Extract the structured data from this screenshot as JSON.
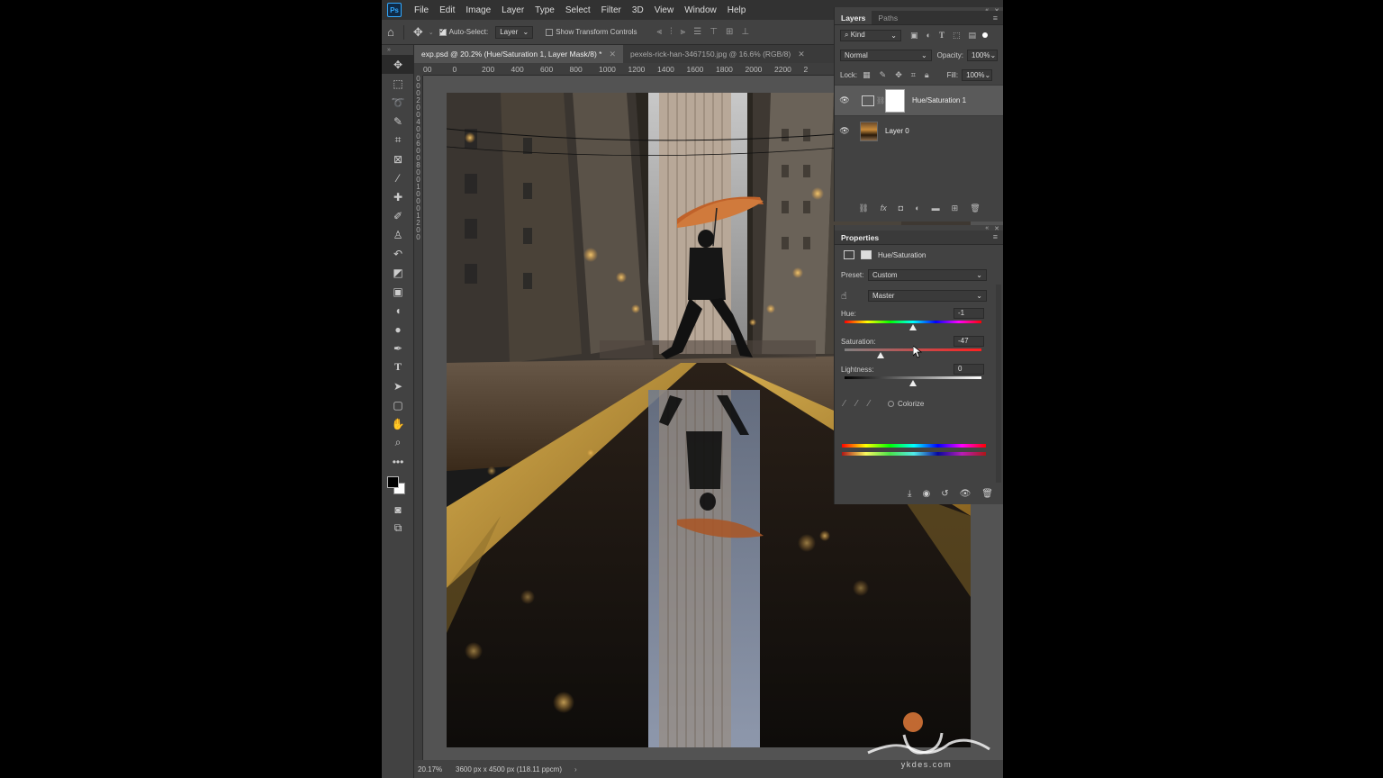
{
  "app": {
    "logo": "Ps",
    "menu": [
      "File",
      "Edit",
      "Image",
      "Layer",
      "Type",
      "Select",
      "Filter",
      "3D",
      "View",
      "Window",
      "Help"
    ]
  },
  "options": {
    "auto_select_label": "Auto-Select:",
    "auto_select_checked": true,
    "target_value": "Layer",
    "show_transform_label": "Show Transform Controls",
    "show_transform_checked": false
  },
  "tabs": [
    {
      "label": "exp.psd @ 20.2% (Hue/Saturation 1, Layer Mask/8) *",
      "active": true
    },
    {
      "label": "pexels-rick-han-3467150.jpg @ 16.6% (RGB/8)",
      "active": false
    }
  ],
  "ruler": {
    "top_labels": [
      "00",
      "0",
      "200",
      "400",
      "600",
      "800",
      "1000",
      "1200",
      "1400",
      "1600",
      "1800",
      "2000",
      "2200",
      "2"
    ],
    "left_digits": [
      "0",
      "0",
      "0",
      "2",
      "0",
      "0",
      "4",
      "0",
      "0",
      "6",
      "0",
      "0",
      "8",
      "0",
      "0",
      "1",
      "0",
      "0",
      "0",
      "1",
      "2",
      "0",
      "0"
    ]
  },
  "statusbar": {
    "zoom": "20.17%",
    "info": "3600 px x 4500 px (118.11 ppcm)",
    "arrow": "›"
  },
  "layers_panel": {
    "tabs": [
      "Layers",
      "Paths"
    ],
    "filter_kind": "Kind",
    "blend_mode": "Normal",
    "opacity_label": "Opacity:",
    "opacity_value": "100%",
    "lock_label": "Lock:",
    "fill_label": "Fill:",
    "fill_value": "100%",
    "layers": [
      {
        "name": "Hue/Saturation 1",
        "selected": true,
        "type": "adjustment"
      },
      {
        "name": "Layer 0",
        "selected": false,
        "type": "image"
      }
    ]
  },
  "properties_panel": {
    "title": "Properties",
    "adjustment_name": "Hue/Saturation",
    "preset_label": "Preset:",
    "preset_value": "Custom",
    "channel_value": "Master",
    "hue_label": "Hue:",
    "hue_value": "-1",
    "hue_min": -180,
    "hue_max": 180,
    "saturation_label": "Saturation:",
    "saturation_value": "-47",
    "saturation_min": -100,
    "saturation_max": 100,
    "lightness_label": "Lightness:",
    "lightness_value": "0",
    "lightness_min": -100,
    "lightness_max": 100,
    "colorize_label": "Colorize",
    "colorize_checked": false
  },
  "watermark": {
    "text": "ykdes.com"
  }
}
